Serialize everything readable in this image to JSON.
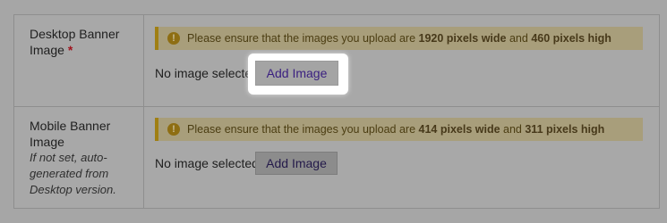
{
  "desktop_banner": {
    "label": "Desktop Banner Image",
    "required_mark": "*",
    "notice_prefix": "Please ensure that the images you upload are ",
    "notice_width": "1920 pixels wide",
    "notice_and": " and ",
    "notice_height": "460 pixels high",
    "status": "No image selected",
    "button_label": "Add Image"
  },
  "mobile_banner": {
    "label": "Mobile Banner Image",
    "hint": "If not set, auto-generated from Desktop version.",
    "notice_prefix": "Please ensure that the images you upload are ",
    "notice_width": "414 pixels wide",
    "notice_and": " and ",
    "notice_height": "311 pixels high",
    "status": "No image selected",
    "button_label": "Add Image"
  },
  "icons": {
    "notice_icon": "info-circle-icon"
  },
  "colors": {
    "required": "#a0141e",
    "notice_border": "#a07f14",
    "button_text_highlighted": "#3a1f80"
  }
}
